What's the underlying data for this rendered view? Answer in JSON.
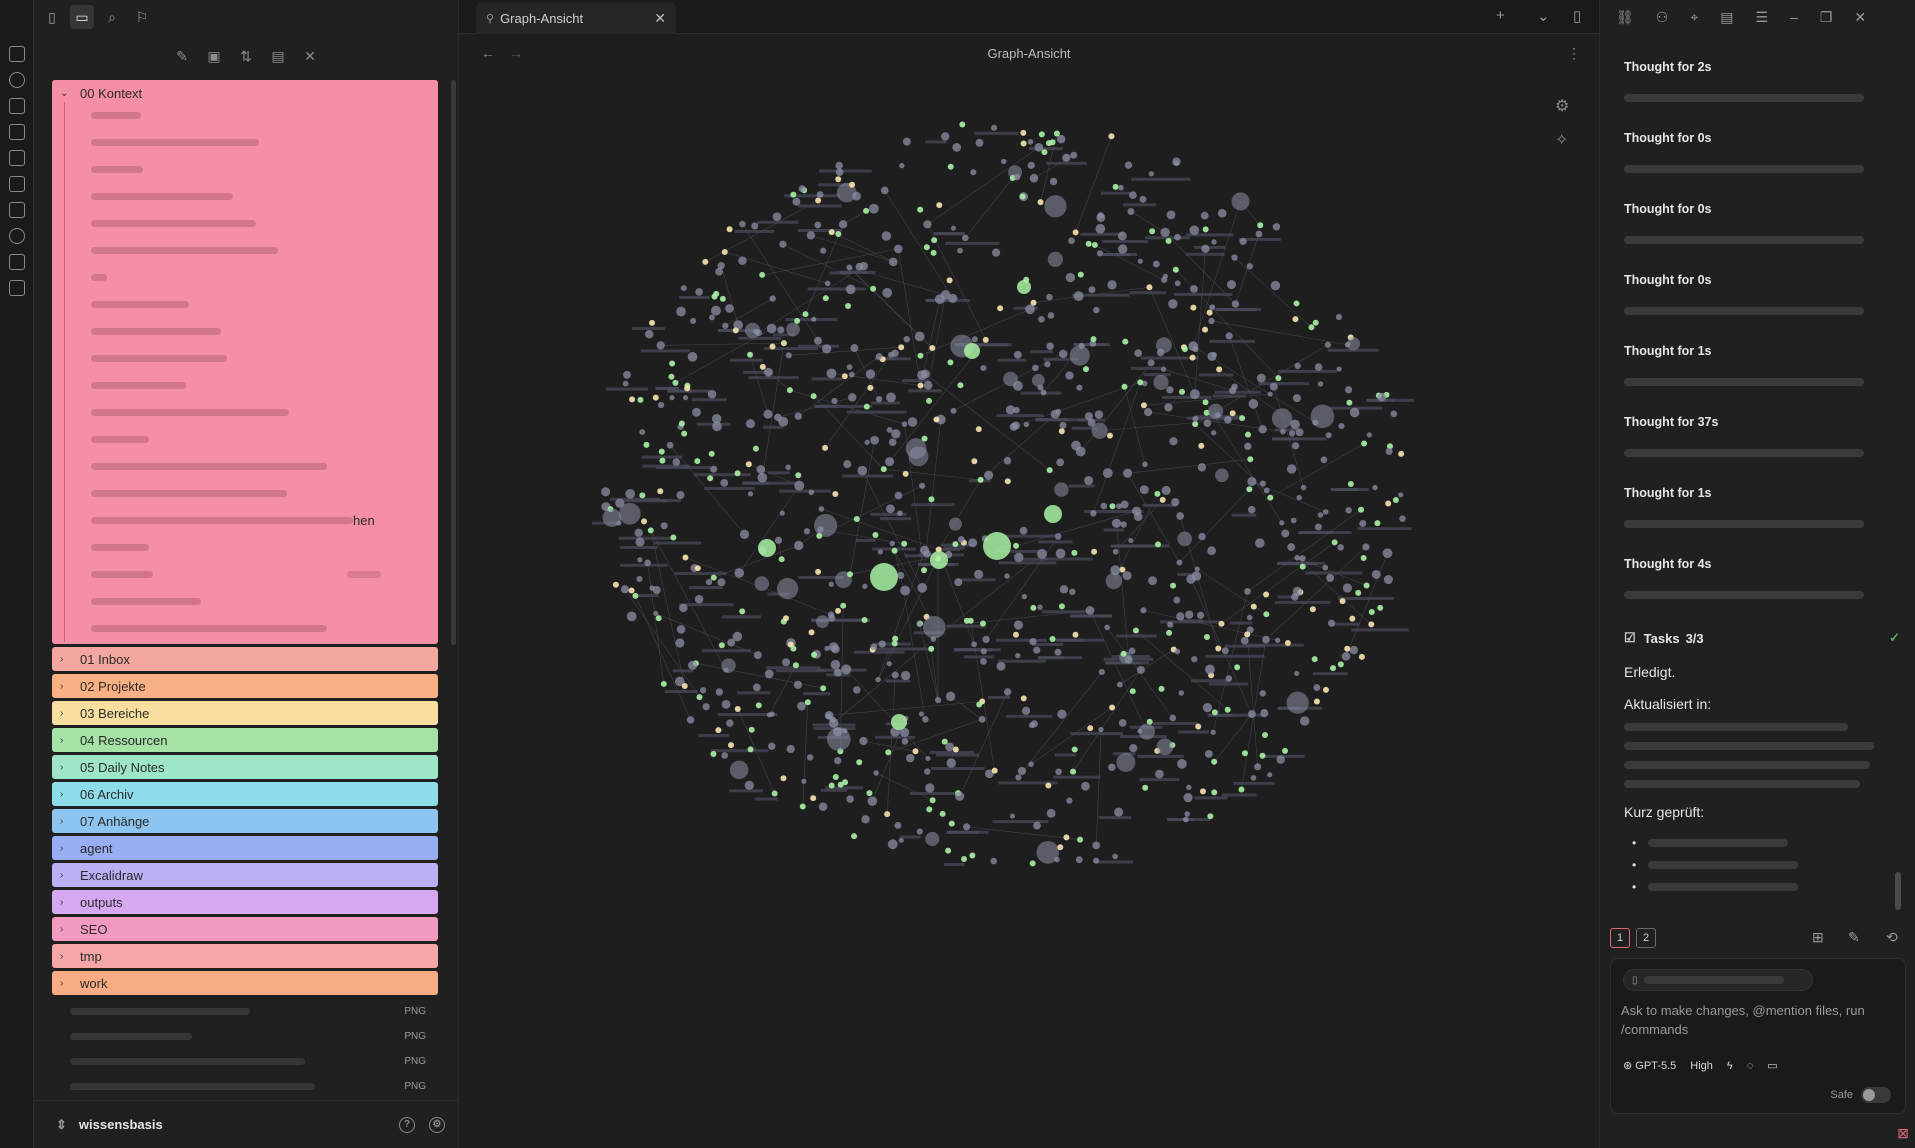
{
  "colors": {
    "background": "#1e1e1e",
    "accent_green": "#a9f2a4",
    "accent_yellow": "#f8e4b0",
    "node_default": "#8c8fa6"
  },
  "tab": {
    "title": "Graph-Ansicht"
  },
  "view": {
    "title": "Graph-Ansicht"
  },
  "explorer": {
    "open_folder": "00 Kontext",
    "folders": [
      {
        "label": "01 Inbox",
        "color": "#f4a6a0"
      },
      {
        "label": "02 Projekte",
        "color": "#f9b184"
      },
      {
        "label": "03 Bereiche",
        "color": "#f8dfa0"
      },
      {
        "label": "04 Ressourcen",
        "color": "#a6e2a6"
      },
      {
        "label": "05 Daily Notes",
        "color": "#9ee6c8"
      },
      {
        "label": "06 Archiv",
        "color": "#8ddcea"
      },
      {
        "label": "07 Anhänge",
        "color": "#8ec4f0"
      },
      {
        "label": "agent",
        "color": "#98aef4"
      },
      {
        "label": "Excalidraw",
        "color": "#b9b0f6"
      },
      {
        "label": "outputs",
        "color": "#d6a8f2"
      },
      {
        "label": "SEO",
        "color": "#f29ac0"
      },
      {
        "label": "tmp",
        "color": "#f6a6a6"
      },
      {
        "label": "work",
        "color": "#f8ac84"
      }
    ],
    "partial_text": "hen",
    "files": [
      {
        "ext": "PNG"
      },
      {
        "ext": "PNG"
      },
      {
        "ext": "PNG"
      },
      {
        "ext": "PNG"
      }
    ],
    "vault_name": "wissensbasis"
  },
  "chat": {
    "thoughts": [
      "Thought for 2s",
      "Thought for 0s",
      "Thought for 0s",
      "Thought for 0s",
      "Thought for 1s",
      "Thought for 37s",
      "Thought for 1s",
      "Thought for 4s"
    ],
    "tasks_label": "Tasks",
    "tasks_count": "3/3",
    "done_text": "Erledigt.",
    "updated_label": "Aktualisiert in:",
    "checked_label": "Kurz geprüft:",
    "pages": [
      "1",
      "2"
    ],
    "placeholder": "Ask to make changes, @mention files, run /commands",
    "model": "GPT-5.5",
    "effort": "High",
    "safe_label": "Safe"
  }
}
